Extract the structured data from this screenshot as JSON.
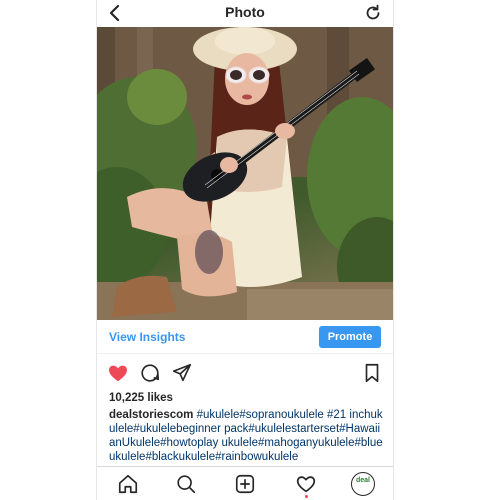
{
  "header": {
    "title": "Photo",
    "back_icon": "chevron-left-icon",
    "refresh_icon": "refresh-icon"
  },
  "post": {
    "image_alt": "Woman in sunglasses and hat playing a black ukulele outdoors",
    "insights_label": "View Insights",
    "promote_label": "Promote",
    "likes": "10,225 likes",
    "username": "dealstoriescom",
    "caption": " #ukulele#sopranoukulele #21 inchukulele#ukulelebeginner pack#ukulelestarterset#HawaiianUkulele#howtoplay ukulele#mahoganyukulele#blueukulele#blackukulele#rainbowukulele"
  },
  "actions": {
    "like_icon": "heart-filled-icon",
    "comment_icon": "comment-icon",
    "share_icon": "send-icon",
    "save_icon": "bookmark-icon"
  },
  "nav": {
    "items": [
      "home-icon",
      "search-icon",
      "add-post-icon",
      "activity-heart-icon",
      "profile-icon"
    ],
    "profile_badge_text": "deal"
  },
  "colors": {
    "accent": "#3897f0",
    "like": "#ed4956",
    "text": "#262626",
    "hashtag": "#003569"
  }
}
